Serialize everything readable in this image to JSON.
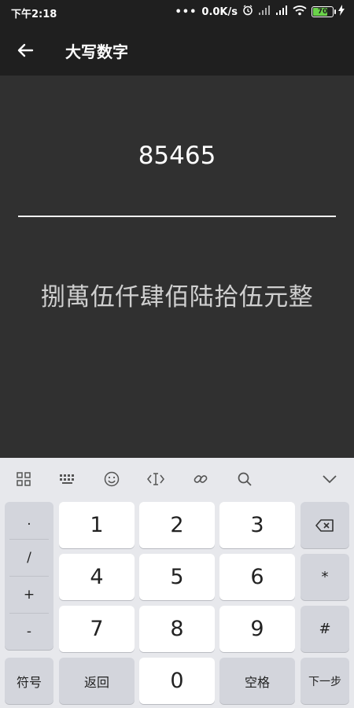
{
  "status": {
    "time": "下午2:18",
    "net_speed": "0.0K/s",
    "battery": "70"
  },
  "appbar": {
    "title": "大写数字"
  },
  "content": {
    "number": "85465",
    "result": "捌萬伍仟肆佰陆拾伍元整"
  },
  "keyboard": {
    "left_symbols": [
      ".",
      "/",
      "+",
      "-"
    ],
    "numbers": [
      "1",
      "2",
      "3",
      "4",
      "5",
      "6",
      "7",
      "8",
      "9",
      "0"
    ],
    "right_keys": [
      "*",
      "#"
    ],
    "symbols_label": "符号",
    "return_label": "返回",
    "space_label": "空格",
    "next_label": "下一步"
  }
}
